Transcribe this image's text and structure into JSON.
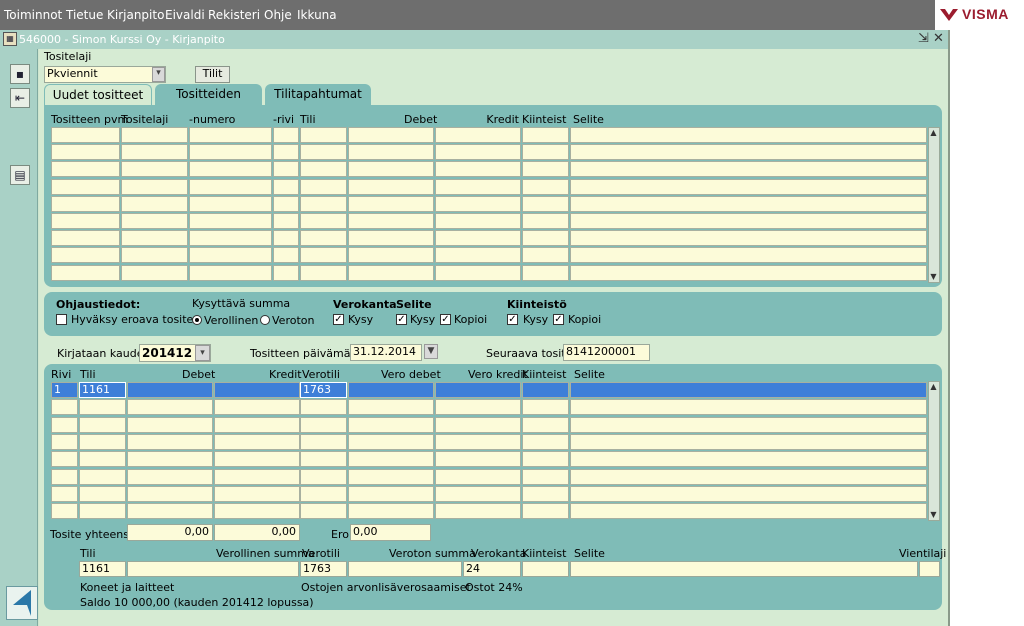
{
  "menubar": {
    "items": [
      {
        "label": "Toiminnot"
      },
      {
        "label": "Tietue"
      },
      {
        "label": "Kirjanpito"
      },
      {
        "label": "Eivaldi"
      },
      {
        "label": "Rekisteri"
      },
      {
        "label": "Ohje"
      },
      {
        "label": "Ikkuna"
      }
    ],
    "logo": "VISMA"
  },
  "window": {
    "title": "546000 - Simon Kurssi Oy - Kirjanpito",
    "controls": "⇲ ✕"
  },
  "header": {
    "tositelaji_label": "Tositelaji",
    "tositelaji_value": "Pkviennit",
    "tilit_button": "Tilit"
  },
  "tabs": [
    {
      "label": "Uudet tositteet",
      "active": true
    },
    {
      "label": "Tositteiden selailu",
      "active": false
    },
    {
      "label": "Tilitapahtumat",
      "active": false
    }
  ],
  "top_table": {
    "headers": [
      "Tositteen pvm",
      "Tositelaji",
      "-numero",
      "-rivi",
      "Tili",
      "Debet",
      "Kredit",
      "Kiinteist",
      "Selite"
    ]
  },
  "ohjaus": {
    "title": "Ohjaustiedot:",
    "hyvaksy": "Hyväksy eroava tosite",
    "kysyttava_label": "Kysyttävä summa",
    "verollinen": "Verollinen",
    "veroton": "Veroton",
    "verokanta_label": "Verokanta",
    "selite_label": "Selite",
    "kiinteisto_label": "Kiinteistö",
    "kysy": "Kysy",
    "kopioi": "Kopioi"
  },
  "period": {
    "kaudelle_label": "Kirjataan kaudelle",
    "kaudelle_value": "201412",
    "pvm_label": "Tositteen päivämäärä",
    "pvm_value": "31.12.2014",
    "seuraava_label": "Seuraava tosite",
    "seuraava_value": "8141200001"
  },
  "entry_table": {
    "headers": [
      "Rivi",
      "Tili",
      "Debet",
      "Kredit",
      "Verotili",
      "Vero debet",
      "Vero kredit",
      "Kiinteist",
      "Selite"
    ],
    "first_row": {
      "rivi": "1",
      "tili": "1161",
      "verotili": "1763"
    }
  },
  "totals": {
    "label": "Tosite yhteensä",
    "debet": "0,00",
    "kredit": "0,00",
    "ero_label": "Ero",
    "ero": "0,00"
  },
  "detail": {
    "headers": [
      "Tili",
      "Verollinen summa",
      "Verotili",
      "Veroton summa",
      "Verokanta",
      "Kiinteist",
      "Selite",
      "Vientilaji"
    ],
    "tili": "1161",
    "verotili": "1763",
    "verokanta": "24",
    "tili_name": "Koneet ja laitteet",
    "saldo": "Saldo 10 000,00  (kauden 201412 lopussa)",
    "verotili_name": "Ostojen arvonlisäverosaamiset",
    "vero_info": "Ostot 24%"
  },
  "colors": {
    "menubar": "#6e6e6e",
    "panel": "#7fbcb7",
    "field": "#fcfbd9",
    "selection": "#3e7fd8",
    "brand": "#9b1c2e"
  }
}
